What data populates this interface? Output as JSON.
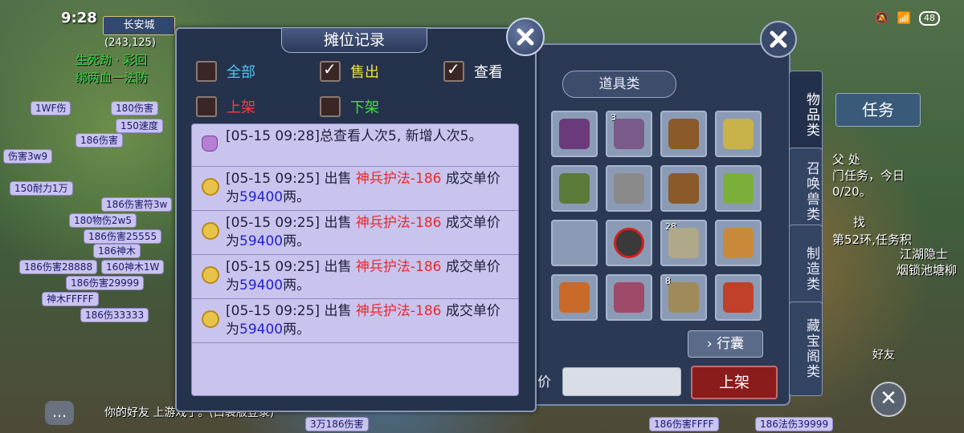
{
  "status_bar": {
    "time": "9:28",
    "battery": "48"
  },
  "location": {
    "name": "长安城",
    "coords": "(243,125)"
  },
  "background_text": {
    "left_lines": [
      "生死劫 · 彩回",
      "绑两血一法防"
    ],
    "chips": [
      "1WF伤",
      "180伤害",
      "150速度",
      "186伤害",
      "伤害3w9",
      "150耐力1万",
      "186伤害符3w",
      "180物伤2w5",
      "186伤害25555",
      "186神木",
      "186伤害28888",
      "160神木1W",
      "186伤害29999",
      "神木FFFFF",
      "186伤33333",
      "3万186伤害",
      "186伤害FFFF",
      "186法伤39999"
    ],
    "right_lines": [
      "父 处",
      "门任务，今日",
      "0/20。",
      "找",
      "第52环,任务积",
      "江湖隐士",
      "烟锁池塘柳"
    ]
  },
  "bottom_notice": "你的好友 上游戏了。(口袋版登录)",
  "record_panel": {
    "title": "摊位记录",
    "filters": [
      {
        "label": "全部",
        "checked": false,
        "color": "#4ec6f0"
      },
      {
        "label": "售出",
        "checked": true,
        "color": "#f0e040"
      },
      {
        "label": "查看",
        "checked": true,
        "color": "#ffffff"
      },
      {
        "label": "上架",
        "checked": false,
        "color": "#ff3a3a"
      },
      {
        "label": "下架",
        "checked": false,
        "color": "#40e040"
      }
    ],
    "entries": [
      {
        "type": "summary",
        "text": "[05-15 09:28]总查看人次5, 新增人次5。"
      },
      {
        "type": "sale",
        "prefix": "[05-15 09:25] 出售 ",
        "item": "神兵护法-186",
        "mid": " 成交单价为",
        "price": "59400",
        "suffix": "两。"
      },
      {
        "type": "sale",
        "prefix": "[05-15 09:25] 出售 ",
        "item": "神兵护法-186",
        "mid": " 成交单价为",
        "price": "59400",
        "suffix": "两。"
      },
      {
        "type": "sale",
        "prefix": "[05-15 09:25] 出售 ",
        "item": "神兵护法-186",
        "mid": " 成交单价为",
        "price": "59400",
        "suffix": "两。"
      },
      {
        "type": "sale",
        "prefix": "[05-15 09:25] 出售 ",
        "item": "神兵护法-186",
        "mid": " 成交单价为",
        "price": "59400",
        "suffix": "两。"
      }
    ]
  },
  "bag_panel": {
    "category": "道具类",
    "side_tabs": [
      "物品类",
      "召唤兽类",
      "制造类",
      "藏宝阁类"
    ],
    "slot_counts": [
      "3",
      "",
      "",
      "28",
      "8"
    ],
    "xingnang_label": "行囊",
    "price_label": "单价",
    "list_button": "上架"
  },
  "right_ui": {
    "task_button": "任务",
    "friend_label": "好友"
  }
}
